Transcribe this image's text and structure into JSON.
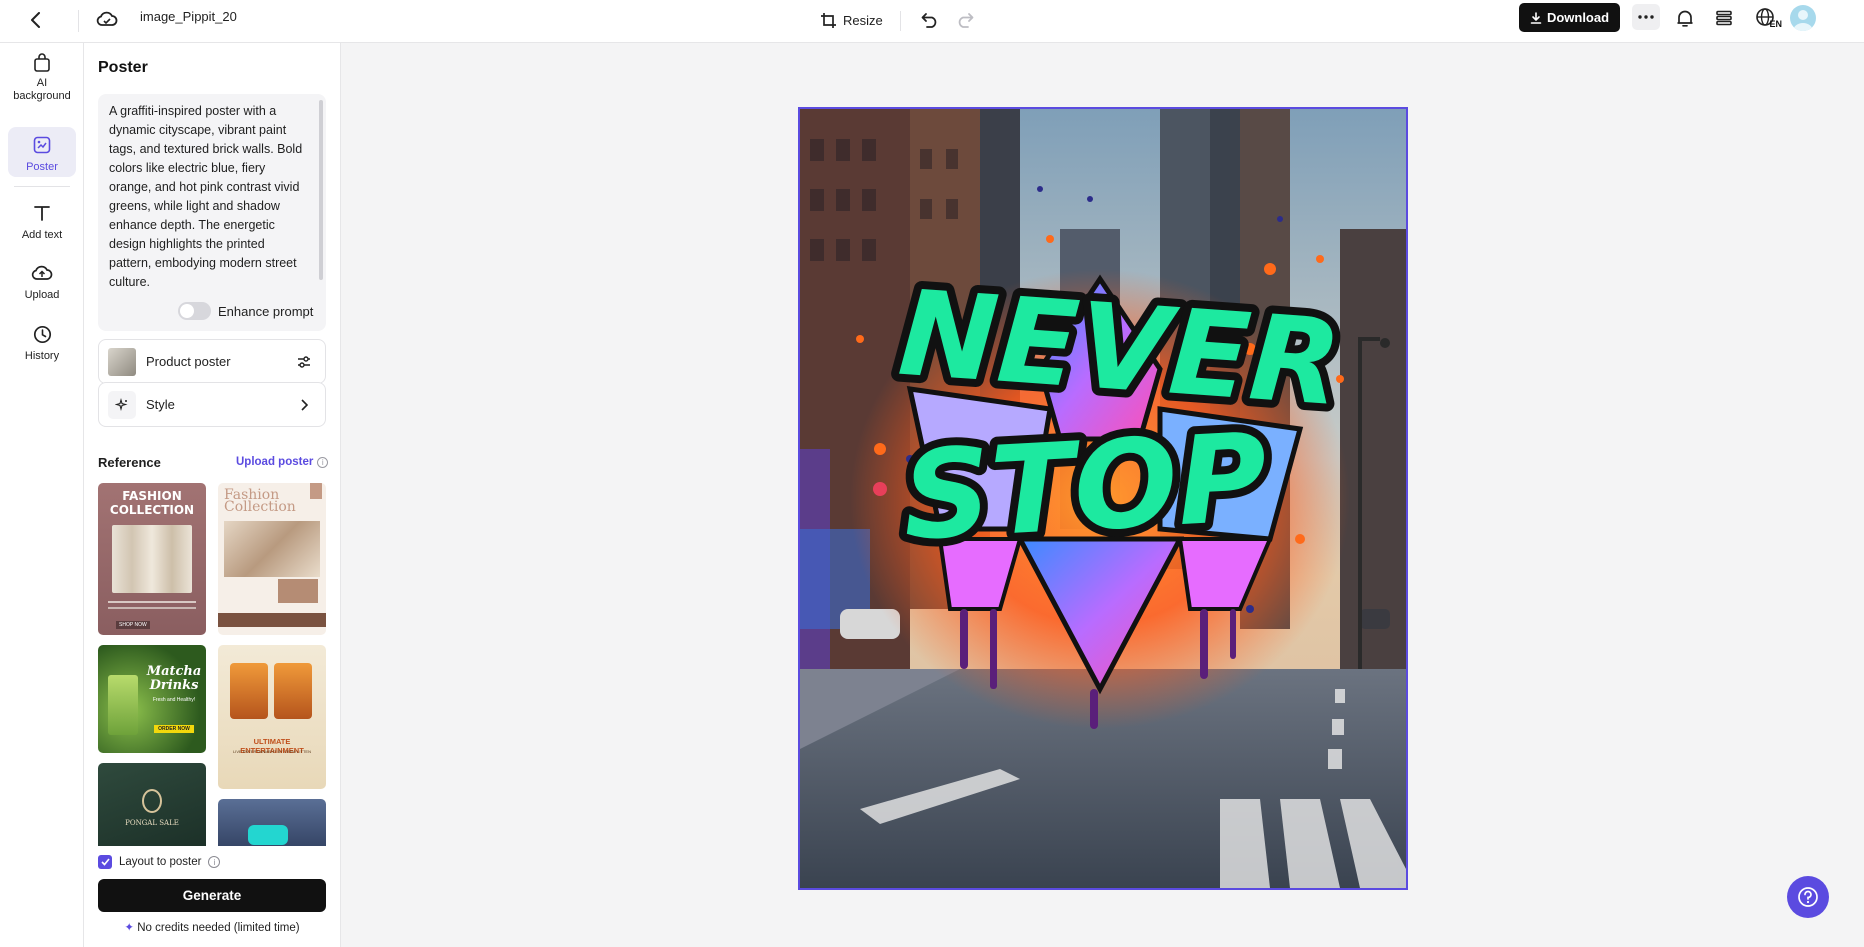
{
  "topbar": {
    "filename": "image_Pippit_20",
    "resize_label": "Resize",
    "download_label": "Download",
    "language_code": "EN"
  },
  "rail": {
    "items": [
      {
        "label": "AI background",
        "icon": "bag-icon"
      },
      {
        "label": "Poster",
        "icon": "poster-icon"
      },
      {
        "label": "Add text",
        "icon": "text-icon"
      },
      {
        "label": "Upload",
        "icon": "upload-icon"
      },
      {
        "label": "History",
        "icon": "history-icon"
      }
    ],
    "active": "Poster"
  },
  "panel": {
    "title": "Poster",
    "prompt": "A graffiti-inspired poster with a dynamic cityscape, vibrant paint tags, and textured brick walls. Bold colors like electric blue, fiery orange, and hot pink contrast vivid greens, while light and shadow enhance depth. The energetic design highlights the printed pattern, embodying modern street culture.",
    "enhance_label": "Enhance prompt",
    "enhance_on": false,
    "product_poster_label": "Product poster",
    "style_label": "Style",
    "reference_title": "Reference",
    "upload_poster_label": "Upload poster",
    "references": [
      {
        "title": "FASHION COLLECTION",
        "tag": "SHOP NOW"
      },
      {
        "title": "Fashion Collection"
      },
      {
        "title": "Matcha Drinks",
        "subtitle": "Fresh and Healthy!",
        "button": "ORDER NOW"
      },
      {
        "title": "ULTIMATE ENTERTAINMENT",
        "subtitle": "LIVE ENTERTAINMENT BY CREW LITTEN"
      },
      {
        "title": "PONGAL SALE"
      },
      {
        "title": ""
      }
    ],
    "layout_label": "Layout to poster",
    "layout_checked": true,
    "generate_label": "Generate",
    "credits_label": "No credits needed (limited time)"
  },
  "canvas": {
    "poster_text_line1": "NEVER",
    "poster_text_line2": "STOP"
  },
  "colors": {
    "accent": "#5b4be0",
    "poster_text": "#1de9a0"
  }
}
